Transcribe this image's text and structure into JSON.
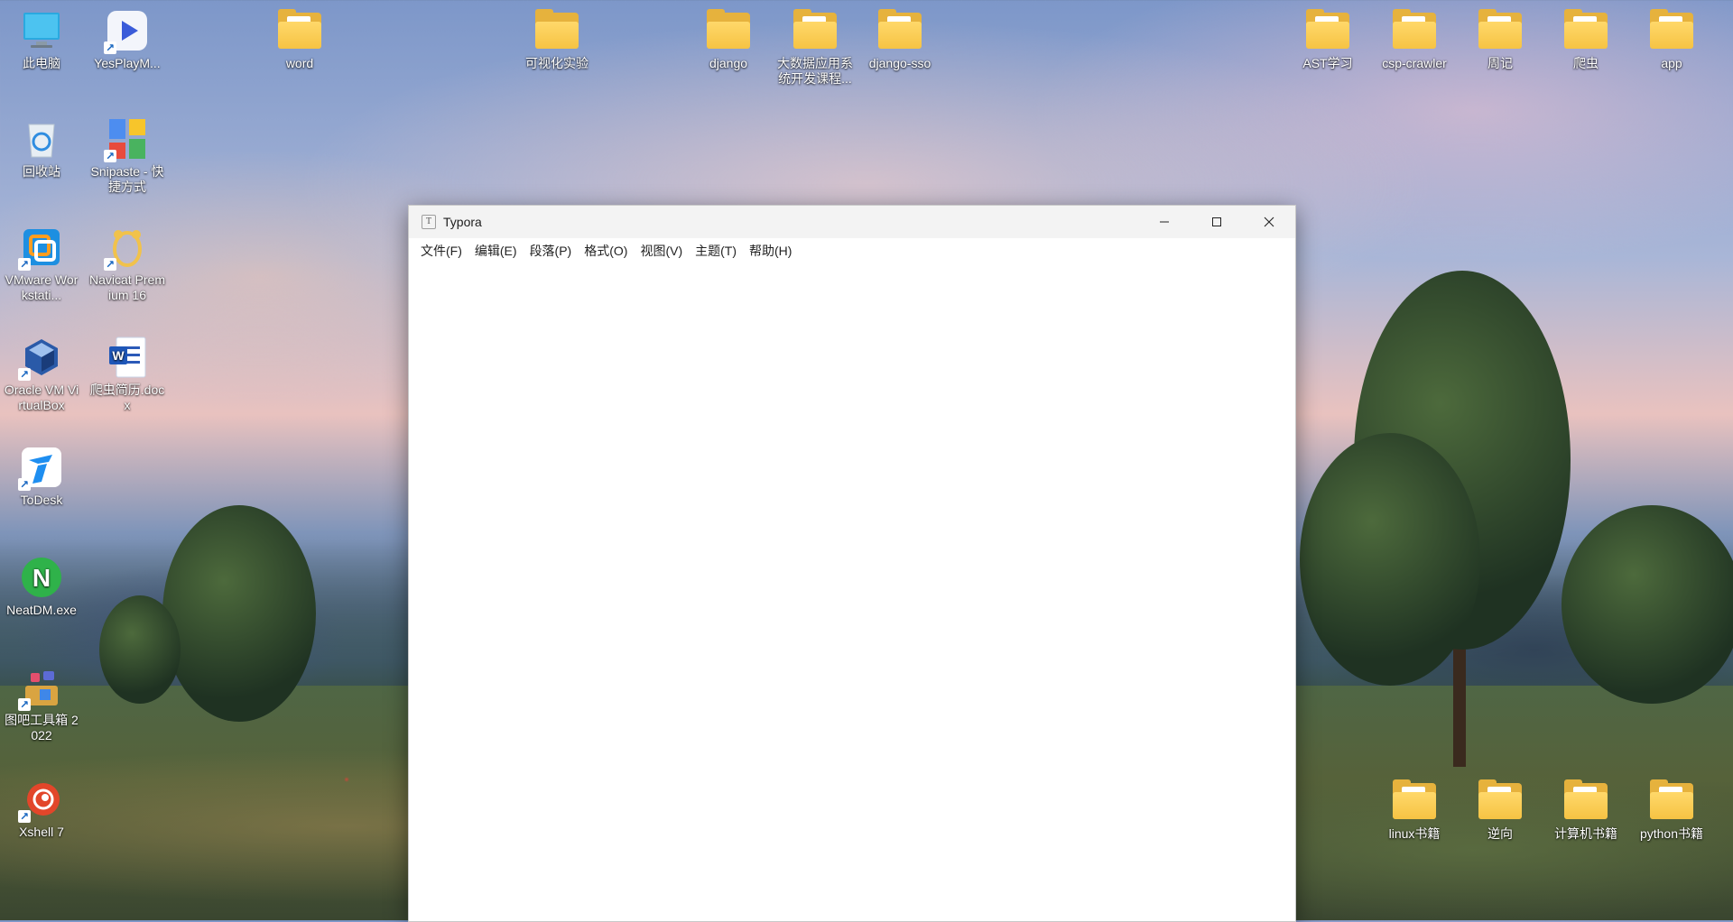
{
  "window": {
    "title": "Typora",
    "menu": [
      "文件(F)",
      "编辑(E)",
      "段落(P)",
      "格式(O)",
      "视图(V)",
      "主题(T)",
      "帮助(H)"
    ]
  },
  "desktop": {
    "left_column_1": [
      {
        "label": "此电脑",
        "icon": "computer-icon"
      },
      {
        "label": "回收站",
        "icon": "recycle-bin-icon"
      },
      {
        "label": "VMware Workstati...",
        "icon": "vmware-icon"
      },
      {
        "label": "Oracle VM VirtualBox",
        "icon": "virtualbox-icon"
      },
      {
        "label": "ToDesk",
        "icon": "todesk-icon"
      },
      {
        "label": "NeatDM.exe",
        "icon": "neatdm-icon"
      },
      {
        "label": "图吧工具箱 2022",
        "icon": "toolbox-icon"
      },
      {
        "label": "Xshell 7",
        "icon": "xshell-icon"
      }
    ],
    "left_column_2": [
      {
        "label": "YesPlayM...",
        "icon": "media-player-icon"
      },
      {
        "label": "Snipaste - 快捷方式",
        "icon": "snipaste-icon"
      },
      {
        "label": "Navicat Premium 16",
        "icon": "navicat-icon"
      },
      {
        "label": "爬虫简历.docx",
        "icon": "word-doc-icon"
      }
    ],
    "top_folders": [
      {
        "label": "word"
      },
      {
        "label": "可视化实验"
      },
      {
        "label": "django"
      },
      {
        "label": "大数据应用系统开发课程..."
      },
      {
        "label": "django-sso"
      },
      {
        "label": "AST学习"
      },
      {
        "label": "csp-crawler"
      },
      {
        "label": "周记"
      },
      {
        "label": "爬虫"
      },
      {
        "label": "app"
      }
    ],
    "bottom_folders": [
      {
        "label": "linux书籍"
      },
      {
        "label": "逆向"
      },
      {
        "label": "计算机书籍"
      },
      {
        "label": "python书籍"
      }
    ]
  }
}
